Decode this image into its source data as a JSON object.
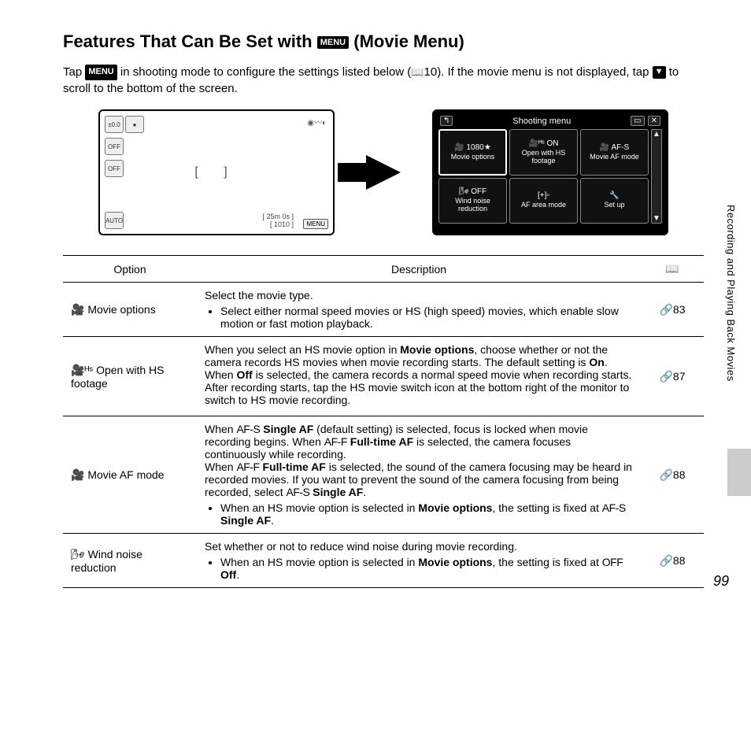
{
  "title_prefix": "Features That Can Be Set with ",
  "title_suffix": " (Movie Menu)",
  "menu_badge": "MENU",
  "intro_part1": "Tap ",
  "intro_part2": " in shooting mode to configure the settings listed below (",
  "intro_ref": "10",
  "intro_part3": "). If the movie menu is not displayed, tap ",
  "intro_part4": " to scroll to the bottom of the screen.",
  "down_arrow": "▼",
  "left_screen": {
    "icons": [
      "±0.0",
      "●",
      "OFF",
      "OFF",
      "AUTO"
    ],
    "top_right": "◉〰◐",
    "brackets": "[   ]",
    "time": "[ 25m 0s ]",
    "res": "[ 1010 ]",
    "menu_btn": "MENU"
  },
  "right_screen": {
    "header_title": "Shooting menu",
    "back": "↰",
    "battery": "▭",
    "close": "✕",
    "cells": [
      {
        "icon": "🎥 1080★",
        "label": "Movie options"
      },
      {
        "icon": "🎥ᴴˢ ON",
        "label": "Open with HS footage"
      },
      {
        "icon": "🎥 AF-S",
        "label": "Movie AF mode"
      },
      {
        "icon": "🌬 OFF",
        "label": "Wind noise reduction"
      },
      {
        "icon": "[+]▫",
        "label": "AF area mode"
      },
      {
        "icon": "🔧",
        "label": "Set up"
      }
    ],
    "scroll_up": "▲",
    "scroll_down": "▼"
  },
  "table": {
    "headers": {
      "option": "Option",
      "description": "Description",
      "ref": "📖"
    },
    "rows": [
      {
        "option_icon": "🎥",
        "option": "Movie options",
        "desc_intro": "Select the movie type.",
        "desc_bullet": "Select either normal speed movies or HS (high speed) movies, which enable slow motion or fast motion playback.",
        "ref": "83"
      },
      {
        "option_icon": "🎥ᴴˢ",
        "option": "Open with HS footage",
        "desc_html": "When you select an HS movie option in <b>Movie options</b>, choose whether or not the camera records HS movies when movie recording starts. The default setting is <b>On</b>.<br>When <b>Off</b> is selected, the camera records a normal speed movie when recording starts. After recording starts, tap the HS movie switch icon at the bottom right of the monitor to switch to HS movie recording.",
        "ref": "87"
      },
      {
        "option_icon": "🎥",
        "option": "Movie AF mode",
        "desc_html": "When <span class='af-label'>AF-S</span> <b>Single AF</b> (default setting) is selected, focus is locked when movie recording begins. When <span class='af-label'>AF-F</span> <b>Full-time AF</b> is selected, the camera focuses continuously while recording.<br>When <span class='af-label'>AF-F</span> <b>Full-time AF</b> is selected, the sound of the camera focusing may be heard in recorded movies. If you want to prevent the sound of the camera focusing from being recorded, select <span class='af-label'>AF-S</span> <b>Single AF</b>.",
        "desc_bullet": "When an HS movie option is selected in <b>Movie options</b>, the setting is fixed at <span class='af-label'>AF-S</span> <b>Single AF</b>.",
        "ref": "88"
      },
      {
        "option_icon": "🌬",
        "option": "Wind noise reduction",
        "desc_intro": "Set whether or not to reduce wind noise during movie recording.",
        "desc_bullet": "When an HS movie option is selected in <b>Movie options</b>, the setting is fixed at <span class='af-label'>OFF</span> <b>Off</b>.",
        "ref": "88"
      }
    ]
  },
  "side_text": "Recording and Playing Back Movies",
  "page_number": "99"
}
